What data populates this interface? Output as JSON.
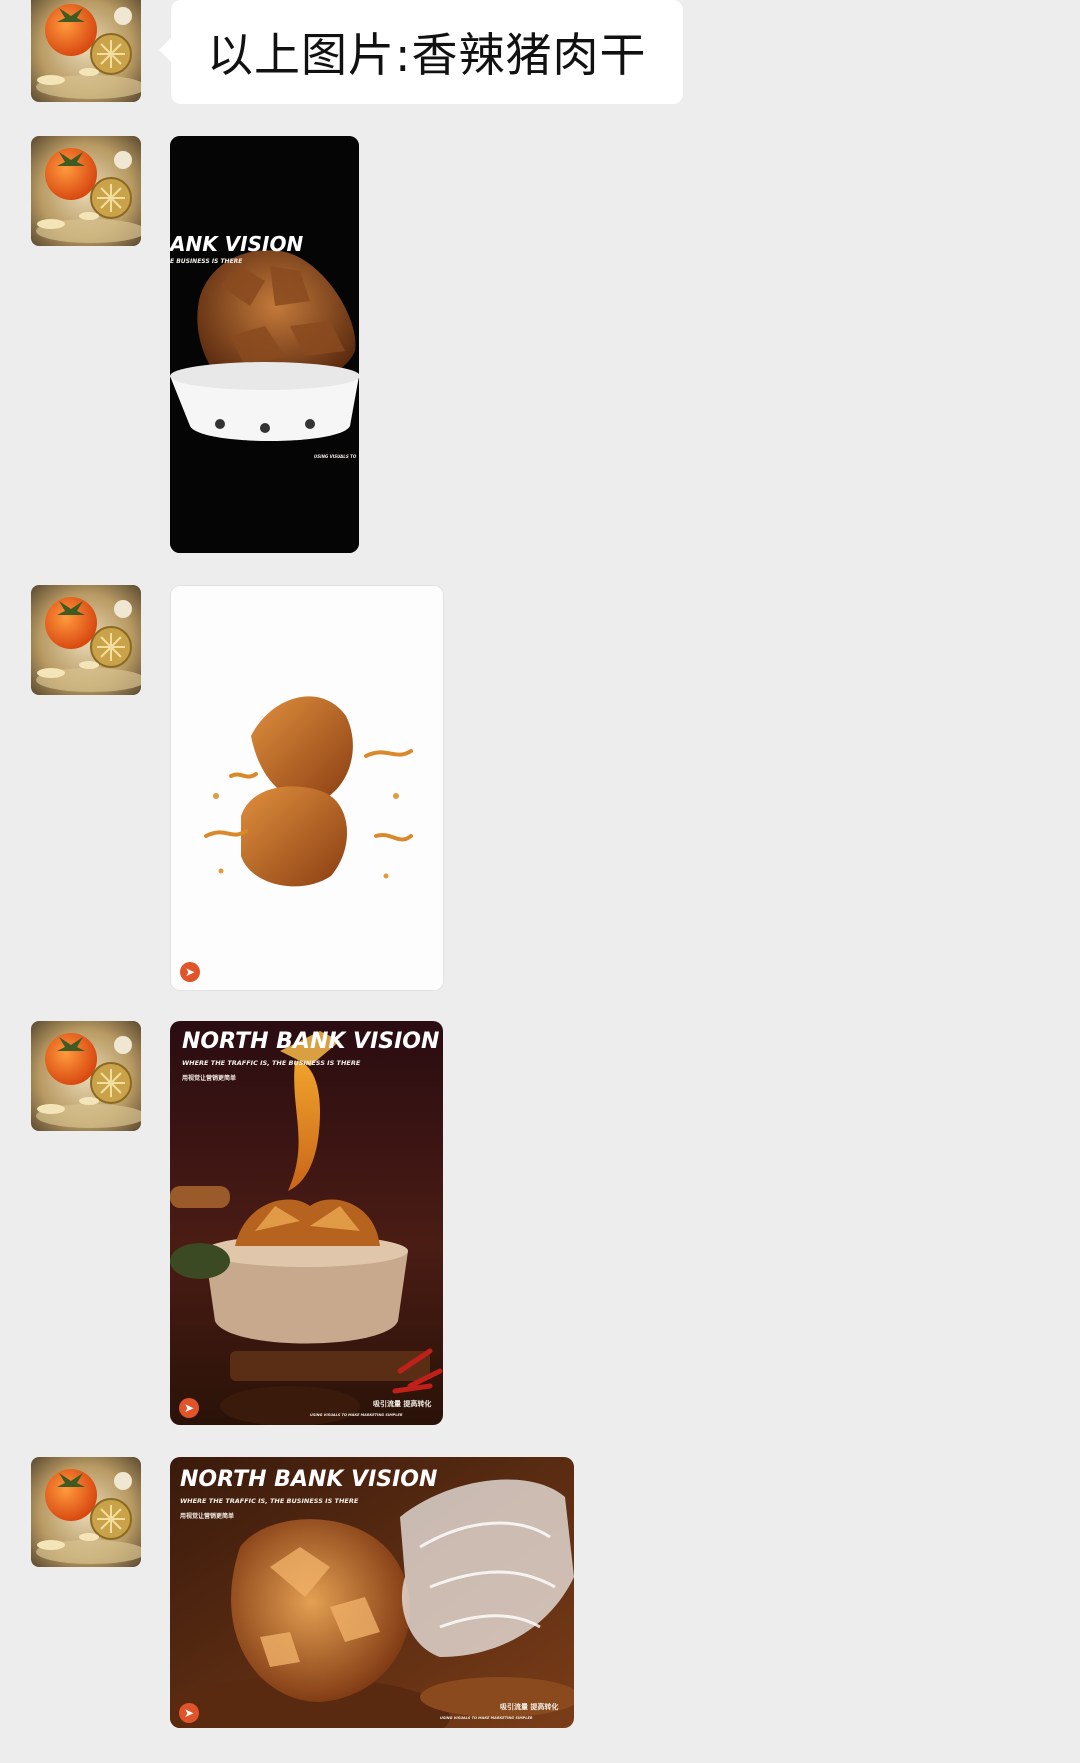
{
  "message_text": "以上图片:香辣猪肉干",
  "avatar_icon": "persimmon-avatar-icon",
  "photos": [
    {
      "title": "ANK VISION",
      "subtitle": "E BUSINESS IS THERE",
      "footer": "USING VISUALS TO"
    },
    {
      "badge_icon": "play-arrow-icon"
    },
    {
      "title": "NORTH BANK VISION",
      "subtitle": "WHERE THE TRAFFIC IS, THE BUSINESS IS THERE",
      "cn_line": "用视觉让营销更简单",
      "cn_footer": "吸引流量 提高转化",
      "footer": "USING VISUALS TO MAKE MARKETING SIMPLER",
      "badge_icon": "play-arrow-icon"
    },
    {
      "title": "NORTH BANK VISION",
      "subtitle": "WHERE THE TRAFFIC IS, THE BUSINESS IS THERE",
      "cn_line": "用视觉让营销更简单",
      "cn_footer": "吸引流量 提高转化",
      "footer": "USING VISUALS TO MAKE MARKETING SIMPLER",
      "badge_icon": "play-arrow-icon"
    }
  ],
  "colors": {
    "background": "#ededed",
    "bubble": "#ffffff",
    "badge": "#e0542b"
  }
}
